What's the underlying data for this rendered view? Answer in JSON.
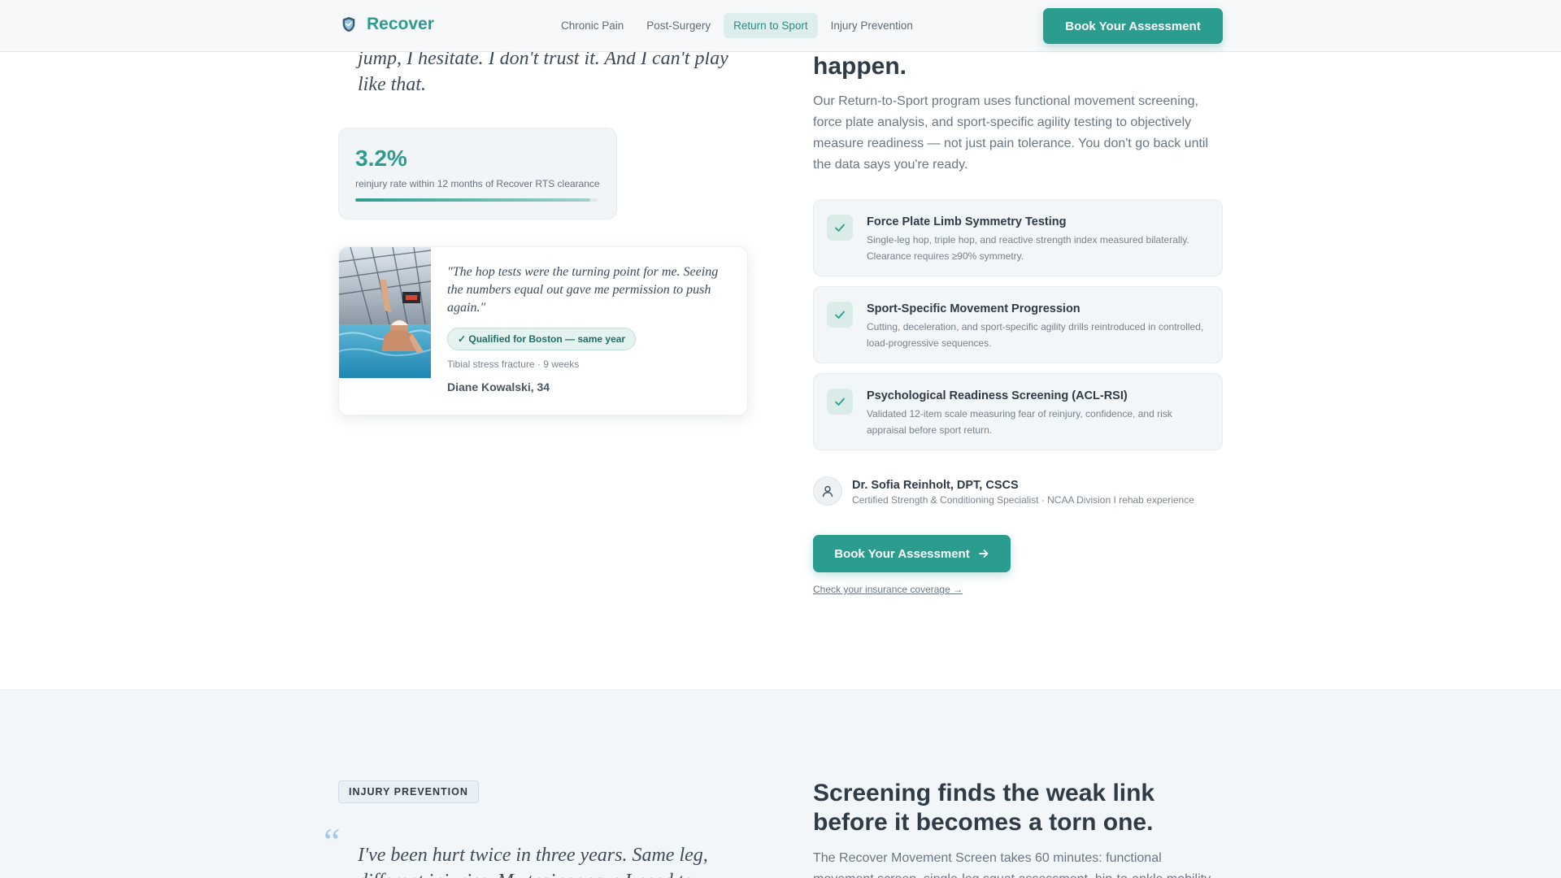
{
  "nav": {
    "brand": "Recover",
    "links": [
      {
        "label": "Chronic Pain"
      },
      {
        "label": "Post-Surgery"
      },
      {
        "label": "Return to Sport"
      },
      {
        "label": "Injury Prevention"
      }
    ],
    "active_link": "Return to Sport",
    "cta": "Book Your Assessment"
  },
  "rts": {
    "quote": "jump, I hesitate. I don't trust it. And I can't play like that.",
    "stat": {
      "value": "3.2%",
      "label": "reinjury rate within 12 months of Recover RTS clearance",
      "bar_fill": 0.97
    },
    "testimonial": {
      "quote": "\"The hop tests were the turning point for me. Seeing the numbers equal out gave me permission to push again.\"",
      "badge": "✓ Qualified for Boston — same year",
      "meta": "Tibial stress fracture · 9 weeks",
      "name": "Diane Kowalski, 34"
    },
    "heading_fragment": "happen.",
    "body": "Our Return-to-Sport program uses functional movement screening, force plate analysis, and sport-specific agility testing to objectively measure readiness — not just pain tolerance. You don't go back until the data says you're ready.",
    "features": [
      {
        "title": "Force Plate Limb Symmetry Testing",
        "desc": "Single-leg hop, triple hop, and reactive strength index measured bilaterally. Clearance requires ≥90% symmetry."
      },
      {
        "title": "Sport-Specific Movement Progression",
        "desc": "Cutting, deceleration, and sport-specific agility drills reintroduced in controlled, load-progressive sequences."
      },
      {
        "title": "Psychological Readiness Screening (ACL-RSI)",
        "desc": "Validated 12-item scale measuring fear of reinjury, confidence, and risk appraisal before sport return."
      }
    ],
    "provider": {
      "name": "Dr. Sofia Reinholt, DPT, CSCS",
      "credentials": "Certified Strength & Conditioning Specialist · NCAA Division I rehab experience"
    },
    "cta": "Book Your Assessment",
    "insurance_link": "Check your insurance coverage →"
  },
  "prevention": {
    "tag": "INJURY PREVENTION",
    "quote_mark": "“",
    "quote": "I've been hurt twice in three years. Same leg, different injuries. My trainer says I need to",
    "heading": "Screening finds the weak link before it becomes a torn one.",
    "body": "The Recover Movement Screen takes 60 minutes: functional movement screen, single-leg squat assessment, hip-to-ankle mobility"
  },
  "colors": {
    "accent": "#2a9d8f",
    "accent_soft": "#dcefec",
    "text_dark": "#2f3b47",
    "text_muted": "#6a7682"
  },
  "icons": [
    "shield-logo-icon",
    "check-icon",
    "user-icon",
    "arrow-right-icon"
  ]
}
